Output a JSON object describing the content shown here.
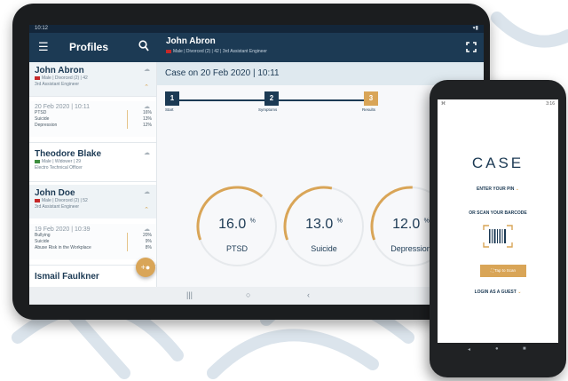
{
  "tablet": {
    "status_time": "10:12",
    "app_bar": {
      "title": "Profiles",
      "patient_name": "John Abron",
      "patient_subtitle": "Male | Divorced (2) | 42 | 3rd Assistant Engineer"
    },
    "profiles": [
      {
        "name": "John Abron",
        "details": "Male | Divorced (2) | 42",
        "role": "3rd Assistant Engineer",
        "case": {
          "date": "20 Feb 2020 | 10:11",
          "rows": [
            {
              "label": "PTSD",
              "value": "16%"
            },
            {
              "label": "Suicide",
              "value": "13%"
            },
            {
              "label": "Depression",
              "value": "12%"
            }
          ]
        }
      },
      {
        "name": "Theodore Blake",
        "details": "Male | Widower | 29",
        "role": "Electro Technical Officer"
      },
      {
        "name": "John Doe",
        "details": "Male | Divorced (2) | 52",
        "role": "3rd Assistant Engineer",
        "case": {
          "date": "19 Feb 2020 | 10:39",
          "rows": [
            {
              "label": "Bullying",
              "value": "20%"
            },
            {
              "label": "Suicide",
              "value": "9%"
            },
            {
              "label": "Abuse Risk in the Workplace",
              "value": "8%"
            }
          ]
        }
      },
      {
        "name": "Ismail Faulkner"
      }
    ],
    "case_header": "Case on 20 Feb 2020 | 10:11",
    "steps": [
      {
        "number": "1",
        "label": "Start"
      },
      {
        "number": "2",
        "label": "Symptoms"
      },
      {
        "number": "3",
        "label": "Results"
      }
    ],
    "gauges": [
      {
        "value": "16.0",
        "unit": "%",
        "label": "PTSD",
        "fraction": 0.16
      },
      {
        "value": "13.0",
        "unit": "%",
        "label": "Suicide",
        "fraction": 0.13
      },
      {
        "value": "12.0",
        "unit": "%",
        "label": "Depression",
        "fraction": 0.12
      }
    ],
    "nav": {
      "recents": "|||",
      "home": "○",
      "back": "‹"
    }
  },
  "phone": {
    "status_time": "3:16",
    "logo": "CASE",
    "enter_pin": "ENTER YOUR PIN",
    "or_scan": "OR SCAN YOUR BARCODE",
    "tap_button": "Tap to Scan",
    "login_guest": "LOGIN AS A GUEST",
    "nav": {
      "back": "◂",
      "home": "●",
      "recents": "■"
    }
  },
  "colors": {
    "navy": "#1c3a54",
    "gold": "#d9a557",
    "light_blue": "#dfe9ef"
  }
}
